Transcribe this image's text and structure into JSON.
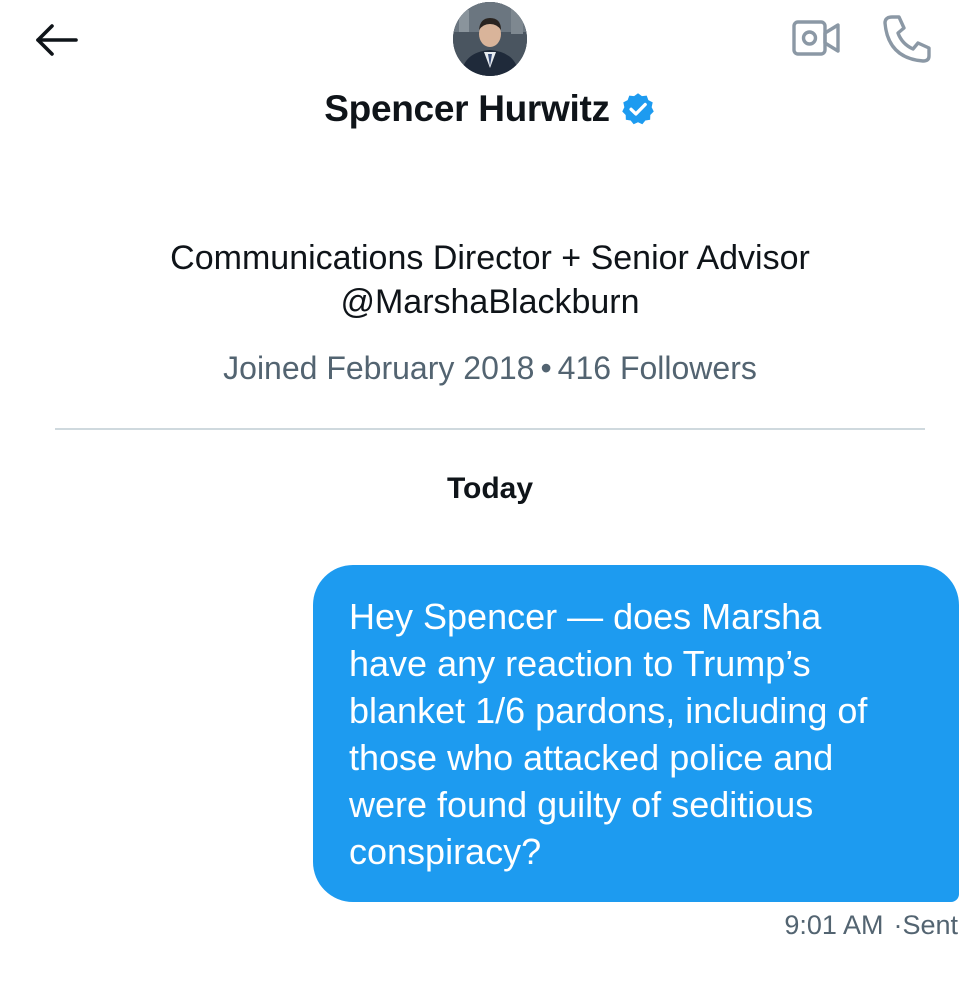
{
  "header": {
    "back_icon": "arrow-left-icon",
    "avatar_icon": "profile-photo",
    "video_icon": "video-camera-icon",
    "call_icon": "phone-icon",
    "verified_icon": "verified-badge-icon",
    "verified_color": "#1d9bf0"
  },
  "profile": {
    "name": "Spencer Hurwitz",
    "bio_line1": "Communications Director + Senior Advisor",
    "bio_line2": "@MarshaBlackburn",
    "joined": "Joined February 2018",
    "separator": "•",
    "followers": "416 Followers"
  },
  "conversation": {
    "day_label": "Today",
    "messages": [
      {
        "text": "Hey Spencer — does Marsha\nhave any reaction to Trump’s\nblanket 1/6 pardons, including of\nthose who attacked police and\nwere found guilty of seditious\nconspiracy?",
        "time": "9:01 AM",
        "status": "·Sent",
        "bubble_color": "#1d9bf0"
      }
    ]
  }
}
